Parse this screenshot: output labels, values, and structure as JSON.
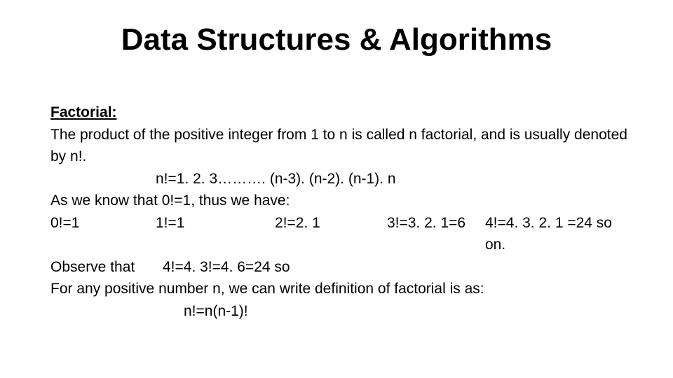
{
  "title": "Data Structures & Algorithms",
  "subhead": "Factorial:",
  "p1": "The product of the positive integer from 1 to n is called n factorial, and is usually denoted by n!.",
  "formula1": "n!=1. 2. 3………. (n-3). (n-2). (n-1). n",
  "p2": "As we know that 0!=1, thus we have:",
  "row": {
    "c1": "0!=1",
    "c2": "1!=1",
    "c3": "2!=2. 1",
    "c4": "3!=3. 2. 1=6",
    "c5": "4!=4. 3. 2. 1 =24 so on."
  },
  "obs_label": "Observe that",
  "obs_value": "4!=4. 3!=4. 6=24 so",
  "p3": "For any positive number n, we can write definition of factorial is as:",
  "formula2": "n!=n(n-1)!"
}
